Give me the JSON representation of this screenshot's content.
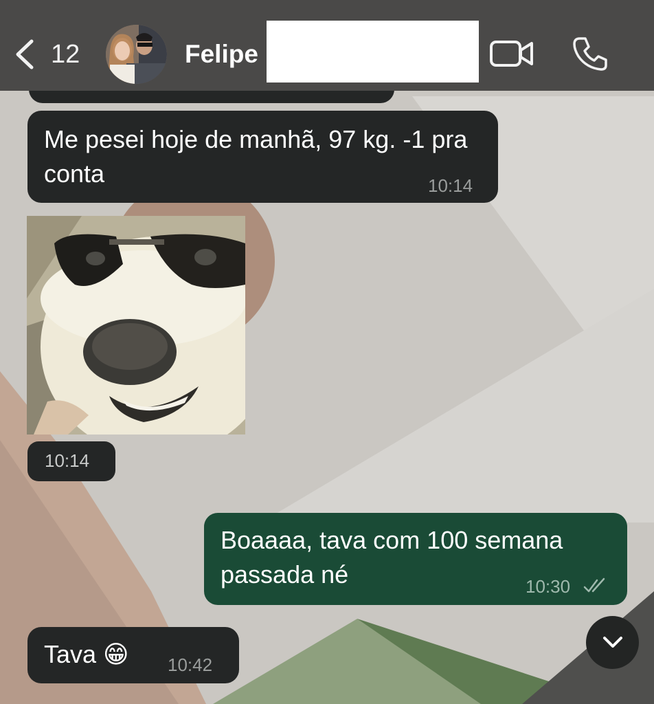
{
  "header": {
    "unread_count": "12",
    "contact_name": "Felipe",
    "back_icon": "chevron-left-icon",
    "video_icon": "video-camera-icon",
    "call_icon": "phone-icon"
  },
  "messages": [
    {
      "direction": "incoming",
      "text": "Me pesei hoje de manhã, 97 kg. -1 pra conta",
      "time": "10:14"
    },
    {
      "direction": "incoming",
      "type": "sticker",
      "description_icon": "dog-sunglasses-sticker",
      "time": "10:14"
    },
    {
      "direction": "outgoing",
      "text": "Boaaaa, tava com 100 semana passada né",
      "time": "10:30",
      "status": "read"
    },
    {
      "direction": "incoming",
      "text": "Tava 😁",
      "time": "10:42"
    }
  ],
  "colors": {
    "header_bg": "#4a4948",
    "incoming_bubble": "#242626",
    "outgoing_bubble": "#1a4b36",
    "read_ticks": "#9fb9ad"
  }
}
